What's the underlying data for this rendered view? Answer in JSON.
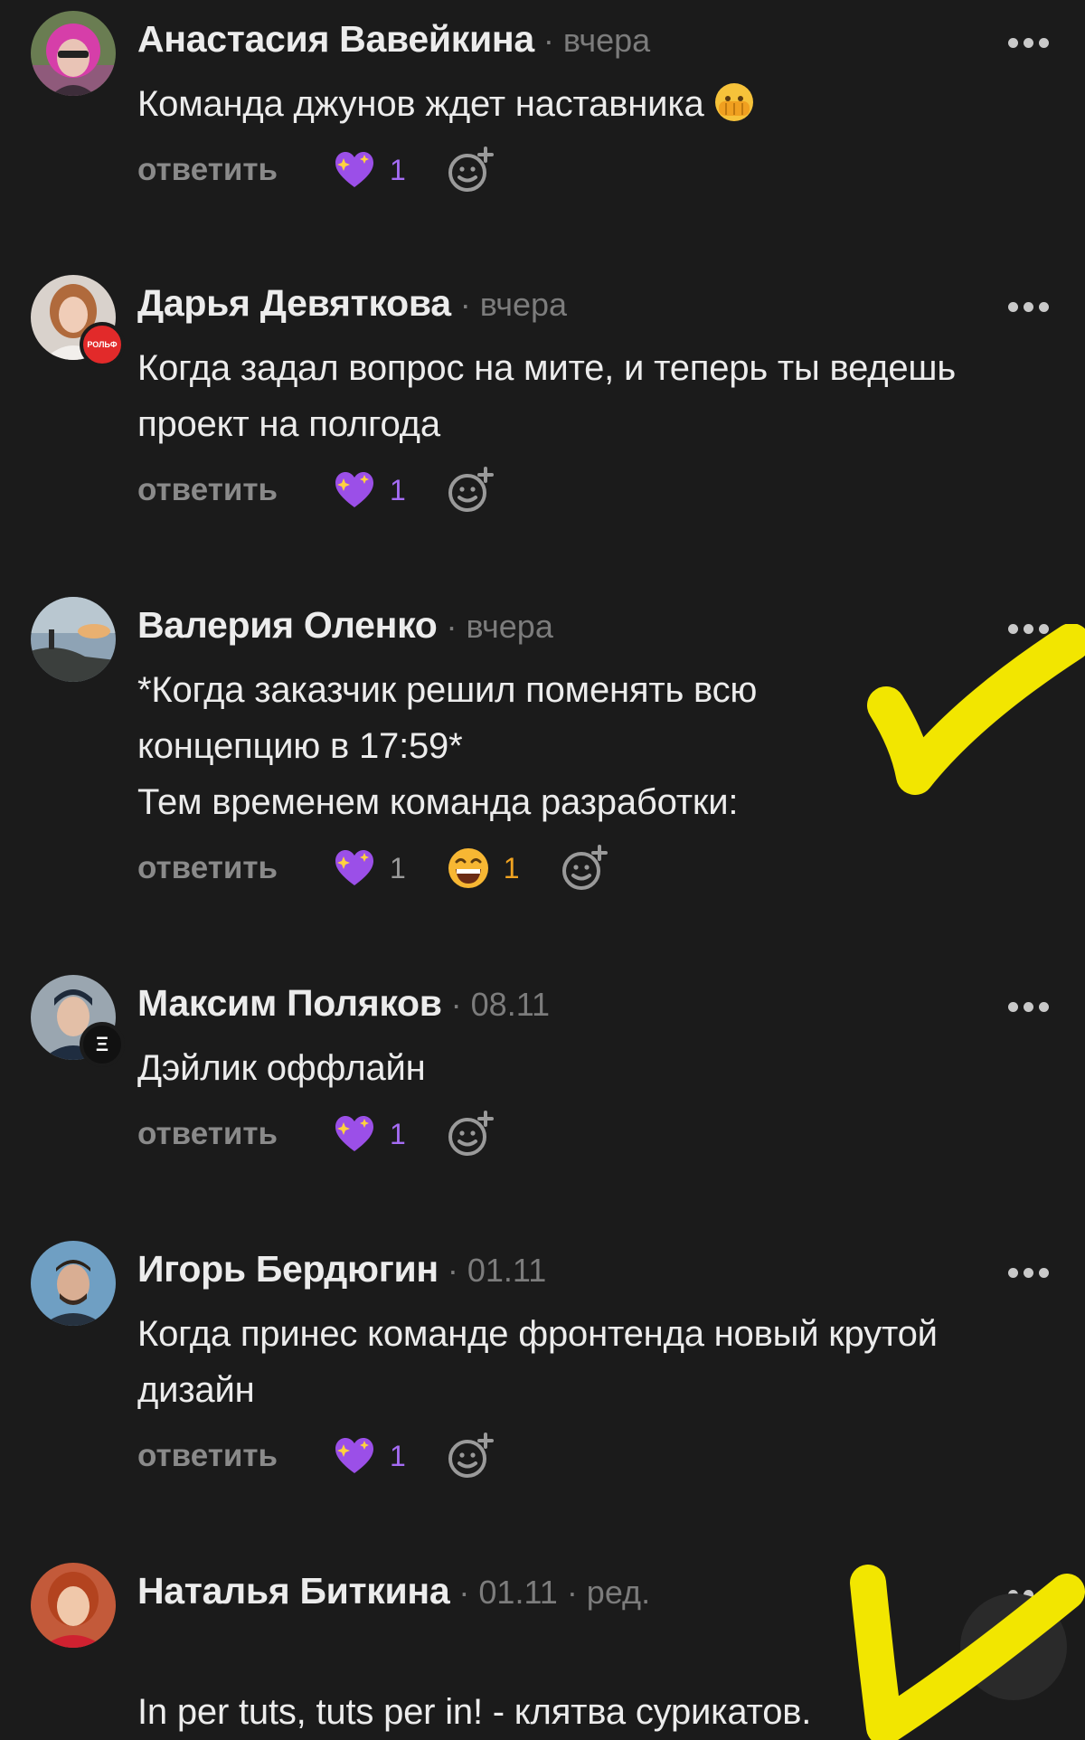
{
  "reply_label": "ответить",
  "comments": [
    {
      "author": "Анастасия Вавейкина",
      "meta": "· вчера",
      "lines": [
        "Команда джунов ждет наставника"
      ],
      "inline_emoji": "peeking-face-emoji",
      "reactions": [
        {
          "icon": "sparkling-heart-icon",
          "count": "1",
          "color": "#a56cf4"
        }
      ]
    },
    {
      "author": "Дарья Девяткова",
      "meta": "· вчера",
      "badge": "РОЛЬФ",
      "lines": [
        "Когда задал вопрос на мите, и теперь ты ведешь",
        "проект на полгода"
      ],
      "reactions": [
        {
          "icon": "sparkling-heart-icon",
          "count": "1",
          "color": "#a56cf4"
        }
      ]
    },
    {
      "author": "Валерия Оленко",
      "meta": "· вчера",
      "lines": [
        "*Когда заказчик решил поменять всю",
        "концепцию в 17:59*",
        "Тем временем команда разработки:"
      ],
      "reactions": [
        {
          "icon": "sparkling-heart-icon",
          "count": "1",
          "color": "#9a9a9a"
        },
        {
          "icon": "grinning-face-icon",
          "count": "1",
          "color": "#f0a321"
        }
      ]
    },
    {
      "author": "Максим Поляков",
      "meta": "· 08.11",
      "badge": "Ξ",
      "lines": [
        "Дэйлик оффлайн"
      ],
      "reactions": [
        {
          "icon": "sparkling-heart-icon",
          "count": "1",
          "color": "#a56cf4"
        }
      ]
    },
    {
      "author": "Игорь Бердюгин",
      "meta": "· 01.11",
      "lines": [
        "Когда принес команде фронтенда новый крутой",
        "дизайн"
      ],
      "reactions": [
        {
          "icon": "sparkling-heart-icon",
          "count": "1",
          "color": "#a56cf4"
        }
      ]
    },
    {
      "author": "Наталья Биткина",
      "meta": "· 01.11 · ред.",
      "lines": [
        "",
        "In per tuts, tuts per in! - клятва сурикатов."
      ],
      "reactions": []
    }
  ],
  "colors": {
    "background": "#1b1b1b",
    "text": "#ececec",
    "meta": "#7c7c7c",
    "reply": "#8a8a8a",
    "accent_purple": "#a56cf4",
    "overlay_check": "#f2e600"
  }
}
